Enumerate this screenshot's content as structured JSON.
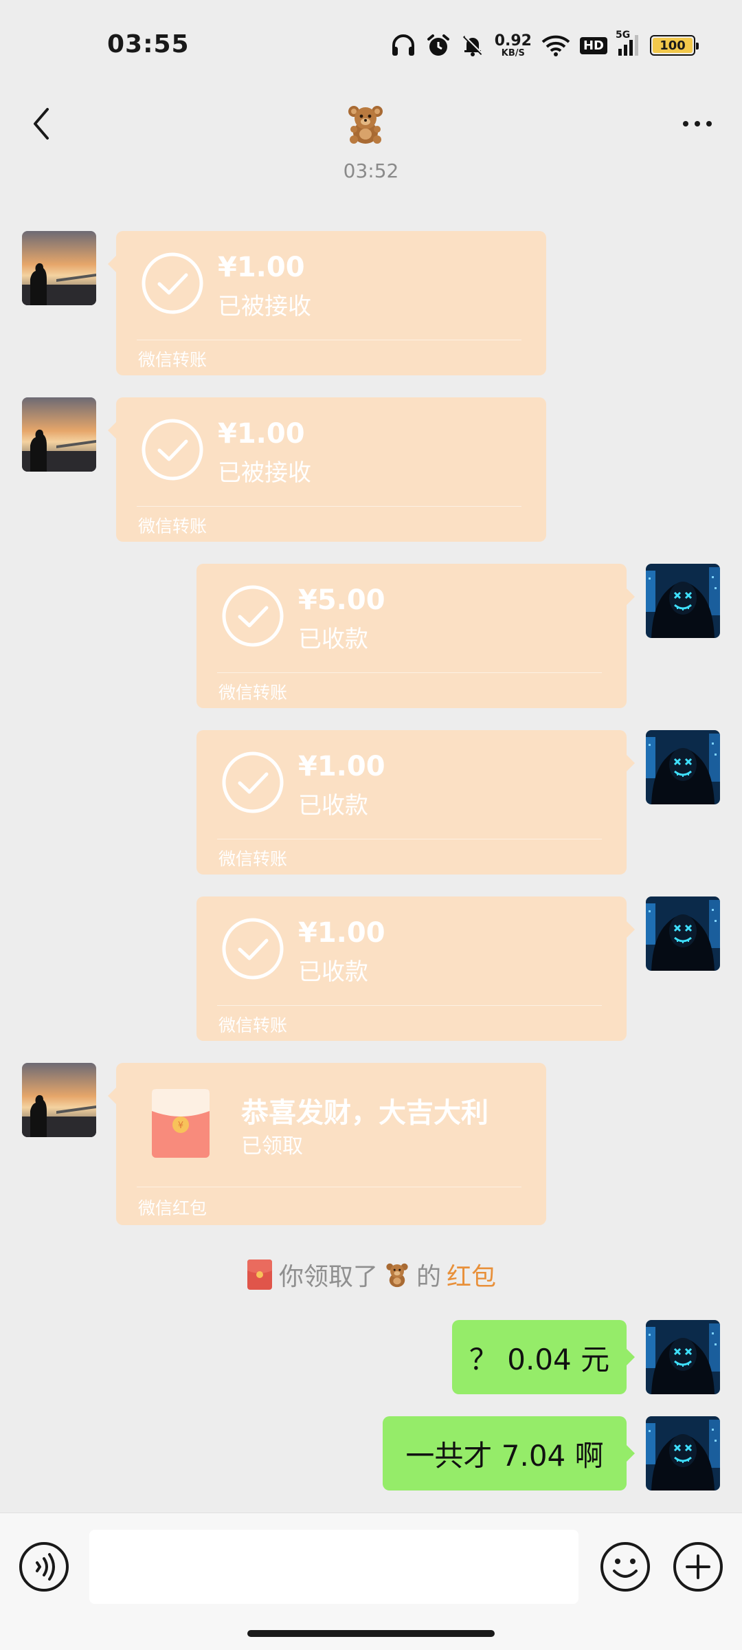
{
  "status_bar": {
    "time": "03:55",
    "network_speed_value": "0.92",
    "network_speed_unit": "KB/S",
    "hd_label": "HD",
    "signal_label": "5G",
    "battery": "100",
    "icons": [
      "headphones-icon",
      "alarm-icon",
      "mute-bell-icon",
      "wifi-icon",
      "signal-icon",
      "battery-icon"
    ]
  },
  "nav": {
    "back_icon": "back-chevron-icon",
    "title_icon": "teddy-bear-emoji",
    "more_icon": "more-dots-icon"
  },
  "chat": {
    "timestamp": "03:52",
    "messages": [
      {
        "side": "left",
        "type": "transfer",
        "amount": "¥1.00",
        "status": "已被接收",
        "footer": "微信转账"
      },
      {
        "side": "left",
        "type": "transfer",
        "amount": "¥1.00",
        "status": "已被接收",
        "footer": "微信转账"
      },
      {
        "side": "right",
        "type": "transfer",
        "amount": "¥5.00",
        "status": "已收款",
        "footer": "微信转账"
      },
      {
        "side": "right",
        "type": "transfer",
        "amount": "¥1.00",
        "status": "已收款",
        "footer": "微信转账"
      },
      {
        "side": "right",
        "type": "transfer",
        "amount": "¥1.00",
        "status": "已收款",
        "footer": "微信转账"
      },
      {
        "side": "left",
        "type": "red_packet",
        "title": "恭喜发财，大吉大利",
        "status": "已领取",
        "footer": "微信红包"
      },
      {
        "side": "right",
        "type": "text",
        "text": "？ 0.04 元"
      },
      {
        "side": "right",
        "type": "text",
        "text": "一共才 7.04 啊"
      }
    ],
    "system_notice": {
      "prefix": "你领取了",
      "suffix": "的",
      "link": "红包"
    }
  },
  "input_bar": {
    "voice_icon": "voice-icon",
    "emoji_icon": "emoji-icon",
    "plus_icon": "plus-icon",
    "text_value": ""
  },
  "colors": {
    "background": "#ededed",
    "transfer_card": "#fbe0c4",
    "sent_bubble": "#95ec69",
    "link": "#e8903a"
  }
}
